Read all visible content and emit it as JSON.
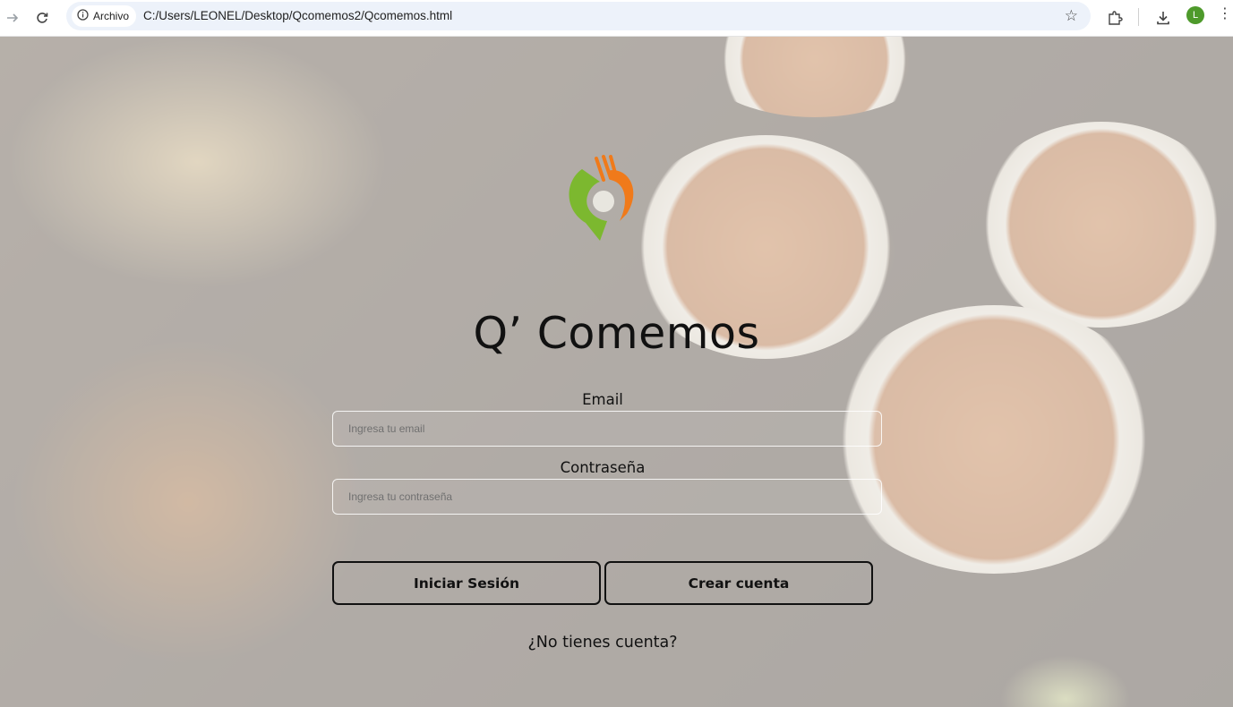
{
  "browser": {
    "site_chip_label": "Archivo",
    "url": "C:/Users/LEONEL/Desktop/Qcomemos2/Qcomemos.html",
    "profile_initial": "L",
    "profile_color": "#4e9a2b"
  },
  "logo": {
    "colors": {
      "green": "#7cb82f",
      "orange": "#f07a1a"
    }
  },
  "page": {
    "title": "Q’ Comemos",
    "email_label": "Email",
    "email_placeholder": "Ingresa tu email",
    "email_value": "",
    "password_label": "Contraseña",
    "password_placeholder": "Ingresa tu contraseña",
    "password_value": "",
    "login_button": "Iniciar Sesión",
    "signup_button": "Crear cuenta",
    "no_account_text": "¿No tienes cuenta?"
  }
}
